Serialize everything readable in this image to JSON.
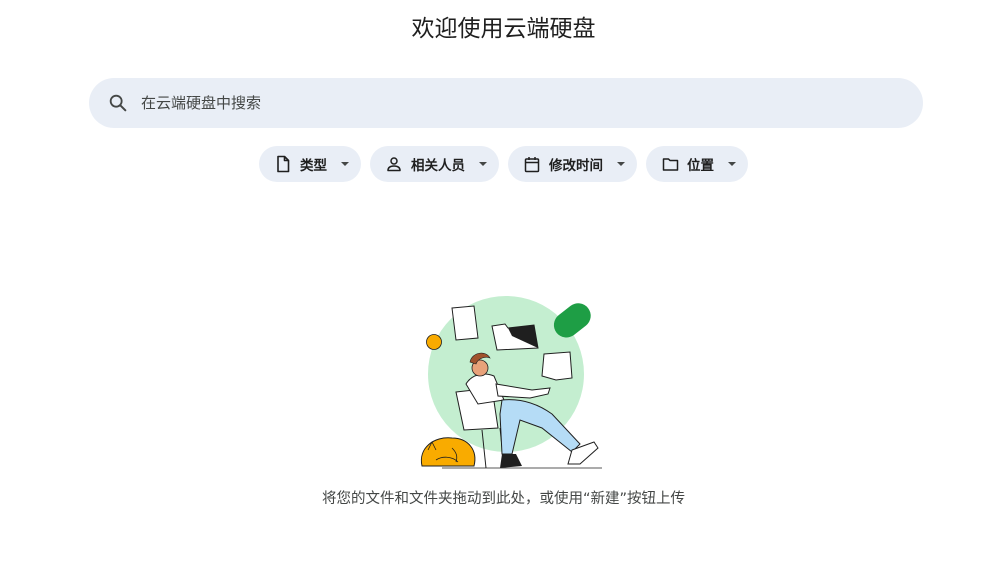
{
  "header": {
    "title": "欢迎使用云端硬盘"
  },
  "search": {
    "placeholder": "在云端硬盘中搜索",
    "icon": "search-icon"
  },
  "filters": [
    {
      "label": "类型",
      "icon": "file-icon"
    },
    {
      "label": "相关人员",
      "icon": "person-icon"
    },
    {
      "label": "修改时间",
      "icon": "calendar-icon"
    },
    {
      "label": "位置",
      "icon": "folder-icon"
    }
  ],
  "empty_state": {
    "message": "将您的文件和文件夹拖动到此处，或使用“新建”按钮上传"
  },
  "colors": {
    "chip_bg": "#e9eef6",
    "illustration_green_light": "#c4eed0",
    "illustration_green": "#1e9e45",
    "illustration_yellow": "#f9ab00"
  }
}
